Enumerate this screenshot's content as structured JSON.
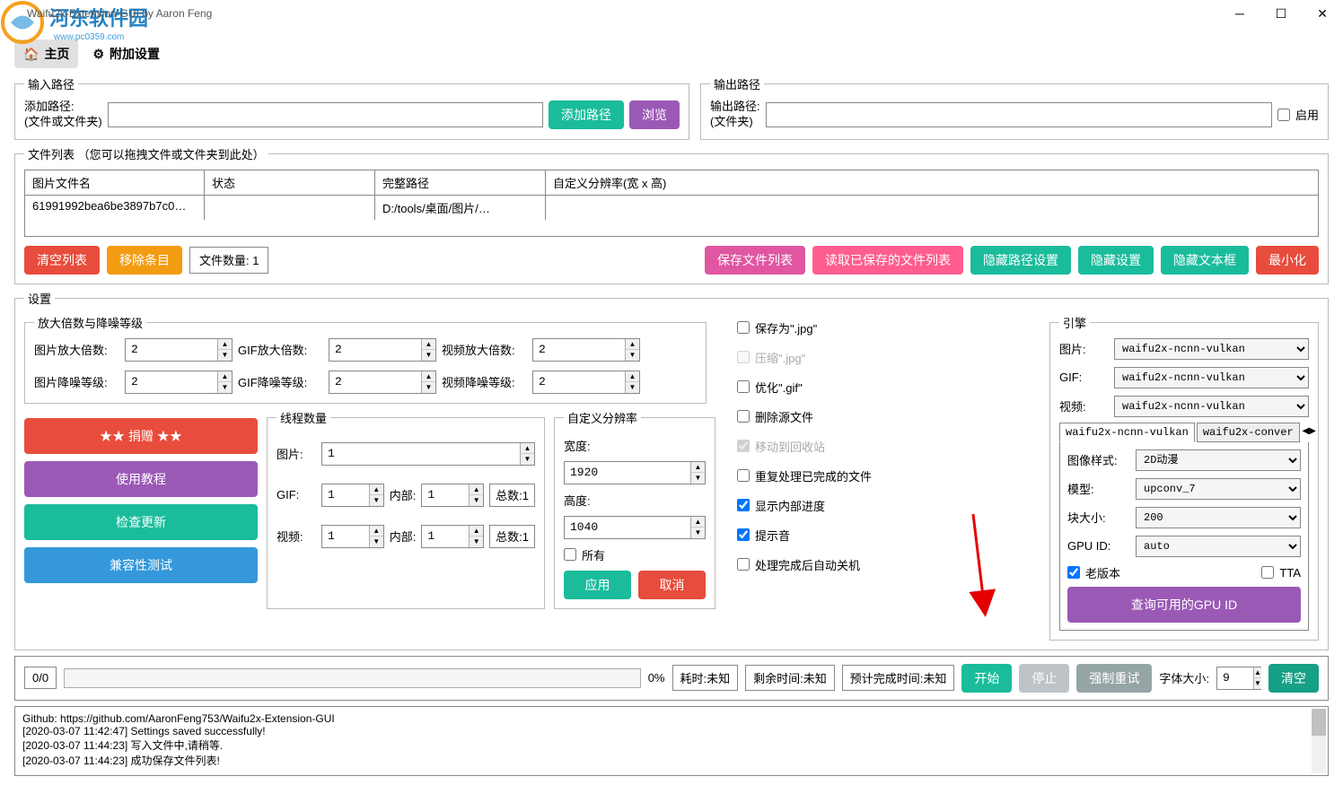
{
  "window": {
    "title": "Waifu2x-Extension-GUI by Aaron Feng"
  },
  "watermark": {
    "text": "河东软件园",
    "url": "www.pc0359.com"
  },
  "tabs": {
    "home": "主页",
    "extra": "附加设置"
  },
  "inputpath": {
    "legend": "输入路径",
    "label": "添加路径:\n(文件或文件夹)",
    "value": "",
    "add_btn": "添加路径",
    "browse_btn": "浏览"
  },
  "outputpath": {
    "legend": "输出路径",
    "label": "输出路径:\n(文件夹)",
    "value": "",
    "enable": "启用"
  },
  "filelist": {
    "legend": "文件列表 （您可以拖拽文件或文件夹到此处）",
    "headers": {
      "name": "图片文件名",
      "status": "状态",
      "fullpath": "完整路径",
      "resolution": "自定义分辨率(宽 x 高)"
    },
    "row": {
      "name": "61991992bea6be3897b7c0…",
      "status": "",
      "fullpath": "D:/tools/桌面/图片/…",
      "resolution": ""
    },
    "clear_btn": "清空列表",
    "remove_btn": "移除条目",
    "count_label": "文件数量: 1",
    "save_btn": "保存文件列表",
    "load_btn": "读取已保存的文件列表",
    "hide_path": "隐藏路径设置",
    "hide_settings": "隐藏设置",
    "hide_textbox": "隐藏文本框",
    "minimize": "最小化"
  },
  "settings": {
    "legend": "设置",
    "scale": {
      "legend": "放大倍数与降噪等级",
      "img_scale": "图片放大倍数:",
      "img_scale_v": "2",
      "gif_scale": "GIF放大倍数:",
      "gif_scale_v": "2",
      "vid_scale": "视频放大倍数:",
      "vid_scale_v": "2",
      "img_noise": "图片降噪等级:",
      "img_noise_v": "2",
      "gif_noise": "GIF降噪等级:",
      "gif_noise_v": "2",
      "vid_noise": "视频降噪等级:",
      "vid_noise_v": "2"
    },
    "actions": {
      "donate": "★★ 捐赠 ★★",
      "tutorial": "使用教程",
      "check_update": "检查更新",
      "compat": "兼容性测试"
    },
    "threads": {
      "legend": "线程数量",
      "img": "图片:",
      "img_v": "1",
      "gif": "GIF:",
      "gif_v": "1",
      "gif_inner": "内部:",
      "gif_inner_v": "1",
      "gif_total": "总数:1",
      "vid": "视频:",
      "vid_v": "1",
      "vid_inner": "内部:",
      "vid_inner_v": "1",
      "vid_total": "总数:1"
    },
    "custom_res": {
      "legend": "自定义分辨率",
      "width": "宽度:",
      "width_v": "1920",
      "height": "高度:",
      "height_v": "1040",
      "all": "所有",
      "apply": "应用",
      "cancel": "取消"
    },
    "checkboxes": {
      "save_jpg": "保存为\".jpg\"",
      "compress_jpg": "压缩\".jpg\"",
      "optimize_gif": "优化\".gif\"",
      "delete_src": "删除源文件",
      "recycle": "移动到回收站",
      "reprocess": "重复处理已完成的文件",
      "show_progress": "显示内部进度",
      "sound": "提示音",
      "auto_shutdown": "处理完成后自动关机"
    },
    "engine": {
      "legend": "引擎",
      "img": "图片:",
      "img_v": "waifu2x-ncnn-vulkan",
      "gif": "GIF:",
      "gif_v": "waifu2x-ncnn-vulkan",
      "vid": "视频:",
      "vid_v": "waifu2x-ncnn-vulkan",
      "tab1": "waifu2x-ncnn-vulkan",
      "tab2": "waifu2x-conver",
      "style": "图像样式:",
      "style_v": "2D动漫",
      "model": "模型:",
      "model_v": "upconv_7",
      "block": "块大小:",
      "block_v": "200",
      "gpu": "GPU ID:",
      "gpu_v": "auto",
      "old_ver": "老版本",
      "tta": "TTA",
      "query_gpu": "查询可用的GPU ID"
    }
  },
  "bottom": {
    "counter": "0/0",
    "pct": "0%",
    "elapsed": "耗时:未知",
    "remaining": "剩余时间:未知",
    "eta": "预计完成时间:未知",
    "start": "开始",
    "stop": "停止",
    "force_retry": "强制重试",
    "font_label": "字体大小:",
    "font_v": "9",
    "clear": "清空"
  },
  "log": {
    "l1": "Github: https://github.com/AaronFeng753/Waifu2x-Extension-GUI",
    "l2": "[2020-03-07 11:42:47] Settings saved successfully!",
    "l3": "[2020-03-07 11:44:23] 写入文件中,请稍等.",
    "l4": "[2020-03-07 11:44:23] 成功保存文件列表!"
  }
}
